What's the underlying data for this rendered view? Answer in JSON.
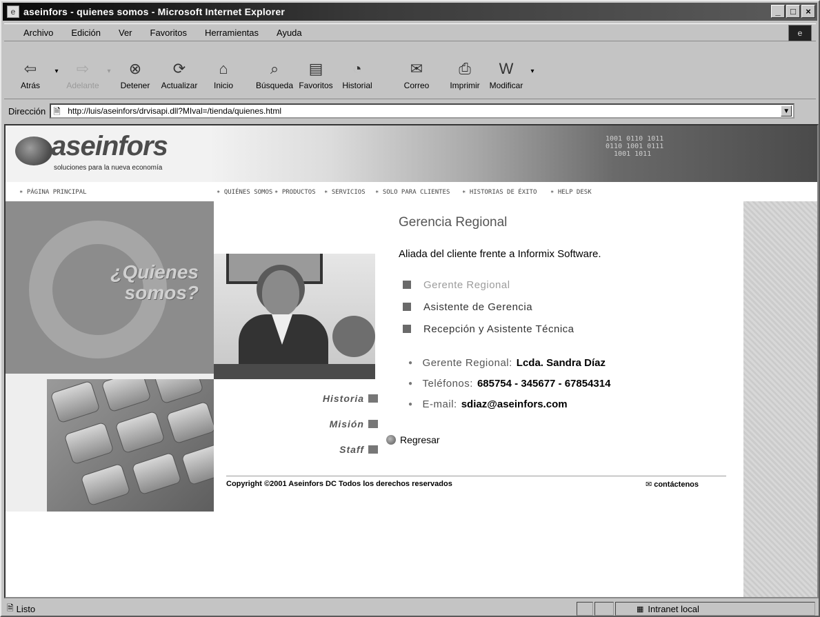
{
  "window": {
    "title": "aseinfors - quienes somos - Microsoft Internet Explorer",
    "controls": [
      "_",
      "□",
      "×"
    ]
  },
  "menu": {
    "items": [
      "Archivo",
      "Edición",
      "Ver",
      "Favoritos",
      "Herramientas",
      "Ayuda"
    ]
  },
  "toolbar": {
    "back": "Atrás",
    "forward": "Adelante",
    "stop": "Detener",
    "refresh": "Actualizar",
    "home": "Inicio",
    "search": "Búsqueda",
    "favorites": "Favoritos",
    "history": "Historial",
    "mail": "Correo",
    "print": "Imprimir",
    "edit": "Modificar"
  },
  "address": {
    "label": "Dirección",
    "url": "http://luis/aseinfors/drvisapi.dll?MIval=/tienda/quienes.html"
  },
  "site": {
    "logo": "aseinfors",
    "tagline": "soluciones para la nueva economía",
    "nav": {
      "home": "PÁGINA PRINCIPAL",
      "about": "QUIÉNES SOMOS",
      "products": "PRODUCTOS",
      "services": "SERVICIOS",
      "clients": "SOLO PARA CLIENTES",
      "stories": "HISTORIAS DE ÉXITO",
      "help": "HELP DESK"
    },
    "hero_text_line1": "¿Quienes",
    "hero_text_line2": "somos?",
    "side_links": {
      "historia": "Historia",
      "mision": "Misión",
      "staff": "Staff"
    },
    "heading": "Gerencia Regional",
    "subheading": "Aliada del cliente frente a Informix Software.",
    "roles": {
      "gerente": "Gerente Regional",
      "asistente": "Asistente de Gerencia",
      "recepcion": "Recepción y Asistente Técnica"
    },
    "details": {
      "gerente_label": "Gerente Regional:",
      "gerente_value": "Lcda. Sandra Díaz",
      "telefonos_label": "Teléfonos:",
      "telefonos_value": "685754 - 345677 - 67854314",
      "email_label": "E-mail:",
      "email_value": "sdiaz@aseinfors.com"
    },
    "back_link": "Regresar",
    "copyright": "Copyright ©2001 Aseinfors DC  Todos los derechos reservados",
    "contact": "contáctenos"
  },
  "status": {
    "text": "Listo",
    "zone": "Intranet local"
  }
}
